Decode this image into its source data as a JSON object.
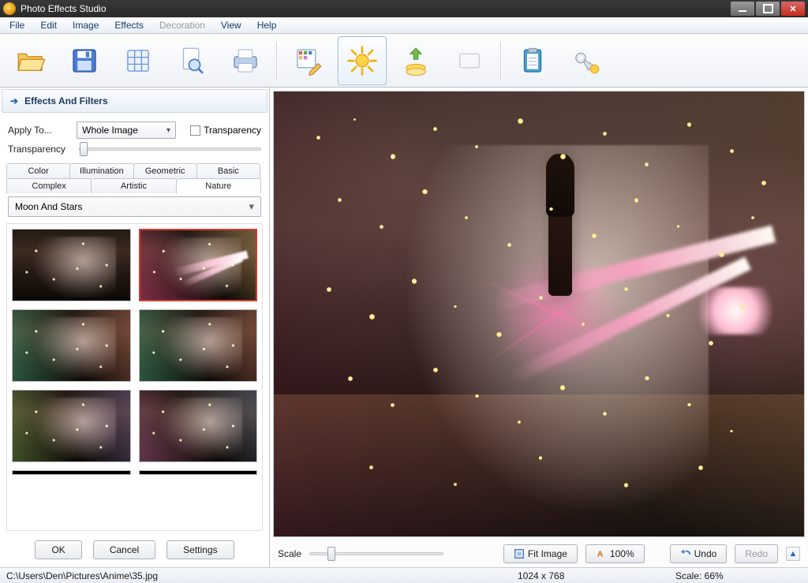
{
  "app": {
    "title": "Photo Effects Studio"
  },
  "menu": {
    "file": "File",
    "edit": "Edit",
    "image": "Image",
    "effects": "Effects",
    "decoration": "Decoration",
    "view": "View",
    "help": "Help"
  },
  "panel": {
    "title": "Effects And Filters",
    "applyToLabel": "Apply To...",
    "applyToValue": "Whole Image",
    "transparencyCheck": "Transparency",
    "transparencyLabel": "Transparency"
  },
  "effectTabs": {
    "color": "Color",
    "illumination": "Illumination",
    "geometric": "Geometric",
    "basic": "Basic",
    "complex": "Complex",
    "artistic": "Artistic",
    "nature": "Nature"
  },
  "effectCategory": "Moon And Stars",
  "buttons": {
    "ok": "OK",
    "cancel": "Cancel",
    "settings": "Settings",
    "fit": "Fit Image",
    "hundred": "100%",
    "undo": "Undo",
    "redo": "Redo"
  },
  "previewControls": {
    "scaleLabel": "Scale"
  },
  "status": {
    "path": "C:\\Users\\Den\\Pictures\\Anime\\35.jpg",
    "dims": "1024 x 768",
    "scale": "Scale: 66%"
  }
}
